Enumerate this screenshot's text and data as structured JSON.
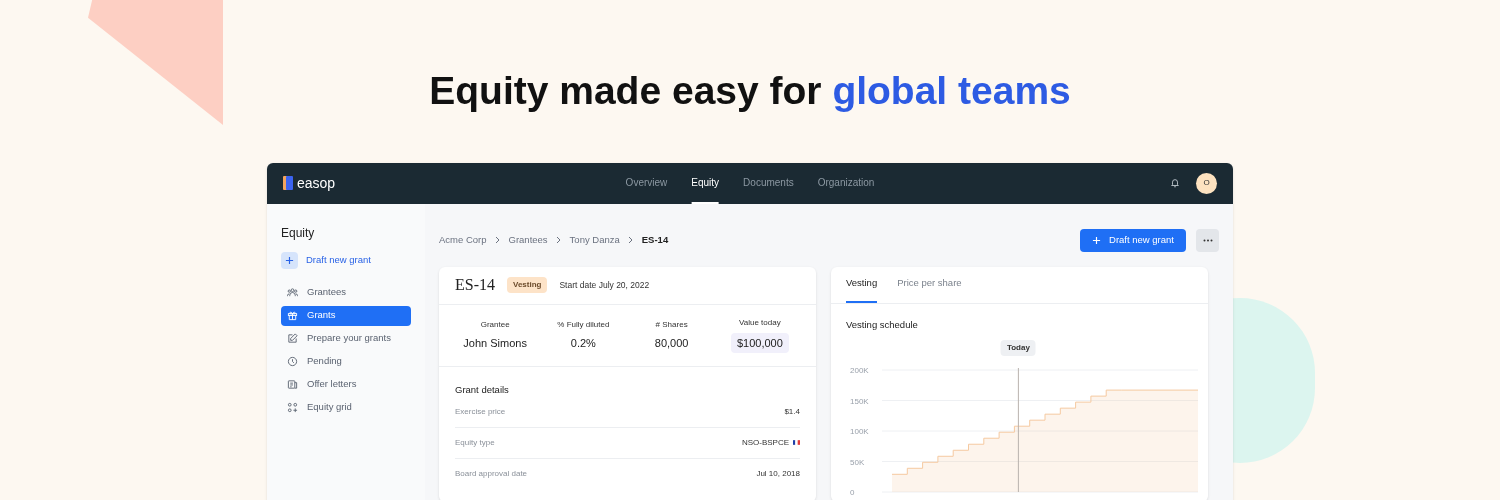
{
  "headline": {
    "text": "Equity made easy for",
    "highlight": "global teams"
  },
  "app": {
    "logo": "easop",
    "nav": [
      {
        "label": "Overview",
        "selected": false
      },
      {
        "label": "Equity",
        "selected": true
      },
      {
        "label": "Documents",
        "selected": false
      },
      {
        "label": "Organization",
        "selected": false
      }
    ],
    "avatar": "O",
    "sidebar": {
      "title": "Equity",
      "action": "Draft new grant",
      "items": [
        {
          "label": "Grantees",
          "selected": false
        },
        {
          "label": "Grants",
          "selected": true
        },
        {
          "label": "Prepare your grants",
          "selected": false
        },
        {
          "label": "Pending",
          "selected": false
        },
        {
          "label": "Offer letters",
          "selected": false
        },
        {
          "label": "Equity grid",
          "selected": false
        }
      ]
    },
    "breadcrumb": [
      "Acme Corp",
      "Grantees",
      "Tony Danza",
      "ES-14"
    ],
    "primary_button": "Draft new grant",
    "grant": {
      "title": "ES-14",
      "status": "Vesting",
      "start": "Start date July 20, 2022",
      "stats": [
        {
          "label": "Grantee",
          "value": "John Simons",
          "highlight": false
        },
        {
          "label": "% Fully diluted",
          "value": "0.2%",
          "highlight": false
        },
        {
          "label": "# Shares",
          "value": "80,000",
          "highlight": false
        },
        {
          "label": "Value today",
          "value": "$100,000",
          "highlight": true
        }
      ],
      "details_title": "Grant details",
      "details": [
        {
          "label": "Exercise price",
          "value": "$1.4",
          "flag": false
        },
        {
          "label": "Equity type",
          "value": "NSO-BSPCE",
          "flag": true
        },
        {
          "label": "Board approval date",
          "value": "Jul 10, 2018",
          "flag": false
        }
      ]
    },
    "chart_panel": {
      "tabs": [
        {
          "label": "Vesting",
          "selected": true
        },
        {
          "label": "Price per share",
          "selected": false
        }
      ],
      "title": "Vesting schedule",
      "chart": {
        "y_labels": [
          "200K",
          "150K",
          "100K",
          "50K",
          "0"
        ],
        "marker": "Today"
      }
    }
  }
}
